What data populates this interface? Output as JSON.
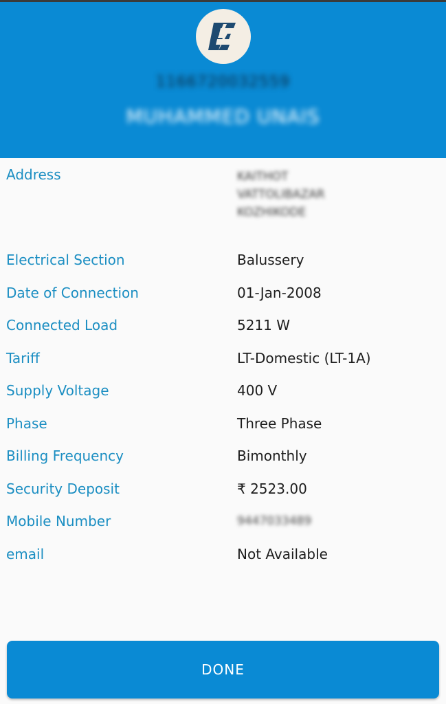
{
  "header": {
    "consumer_number": "1166720032559",
    "consumer_name": "MUHAMMED UNAIS",
    "logo_icon": "kseb-e-logo-icon"
  },
  "details": {
    "address": {
      "label": "Address",
      "lines": [
        "KAITHOT",
        "VATTOLIBAZAR",
        "KOZHIKODE"
      ]
    },
    "electrical_section": {
      "label": "Electrical Section",
      "value": "Balussery"
    },
    "date_of_connection": {
      "label": "Date of Connection",
      "value": "01-Jan-2008"
    },
    "connected_load": {
      "label": "Connected Load",
      "value": "5211 W"
    },
    "tariff": {
      "label": "Tariff",
      "value": "LT-Domestic (LT-1A)"
    },
    "supply_voltage": {
      "label": "Supply Voltage",
      "value": "400 V"
    },
    "phase": {
      "label": "Phase",
      "value": "Three Phase"
    },
    "billing_frequency": {
      "label": "Billing Frequency",
      "value": "Bimonthly"
    },
    "security_deposit": {
      "label": "Security Deposit",
      "value": "₹ 2523.00"
    },
    "mobile_number": {
      "label": "Mobile Number",
      "value": "9447033489"
    },
    "email": {
      "label": "email",
      "value": "Not Available"
    }
  },
  "actions": {
    "done_label": "DONE"
  },
  "colors": {
    "primary": "#0a8ad4",
    "label": "#1b8ec2",
    "value": "#1d1d1d",
    "background": "#fafafa"
  }
}
